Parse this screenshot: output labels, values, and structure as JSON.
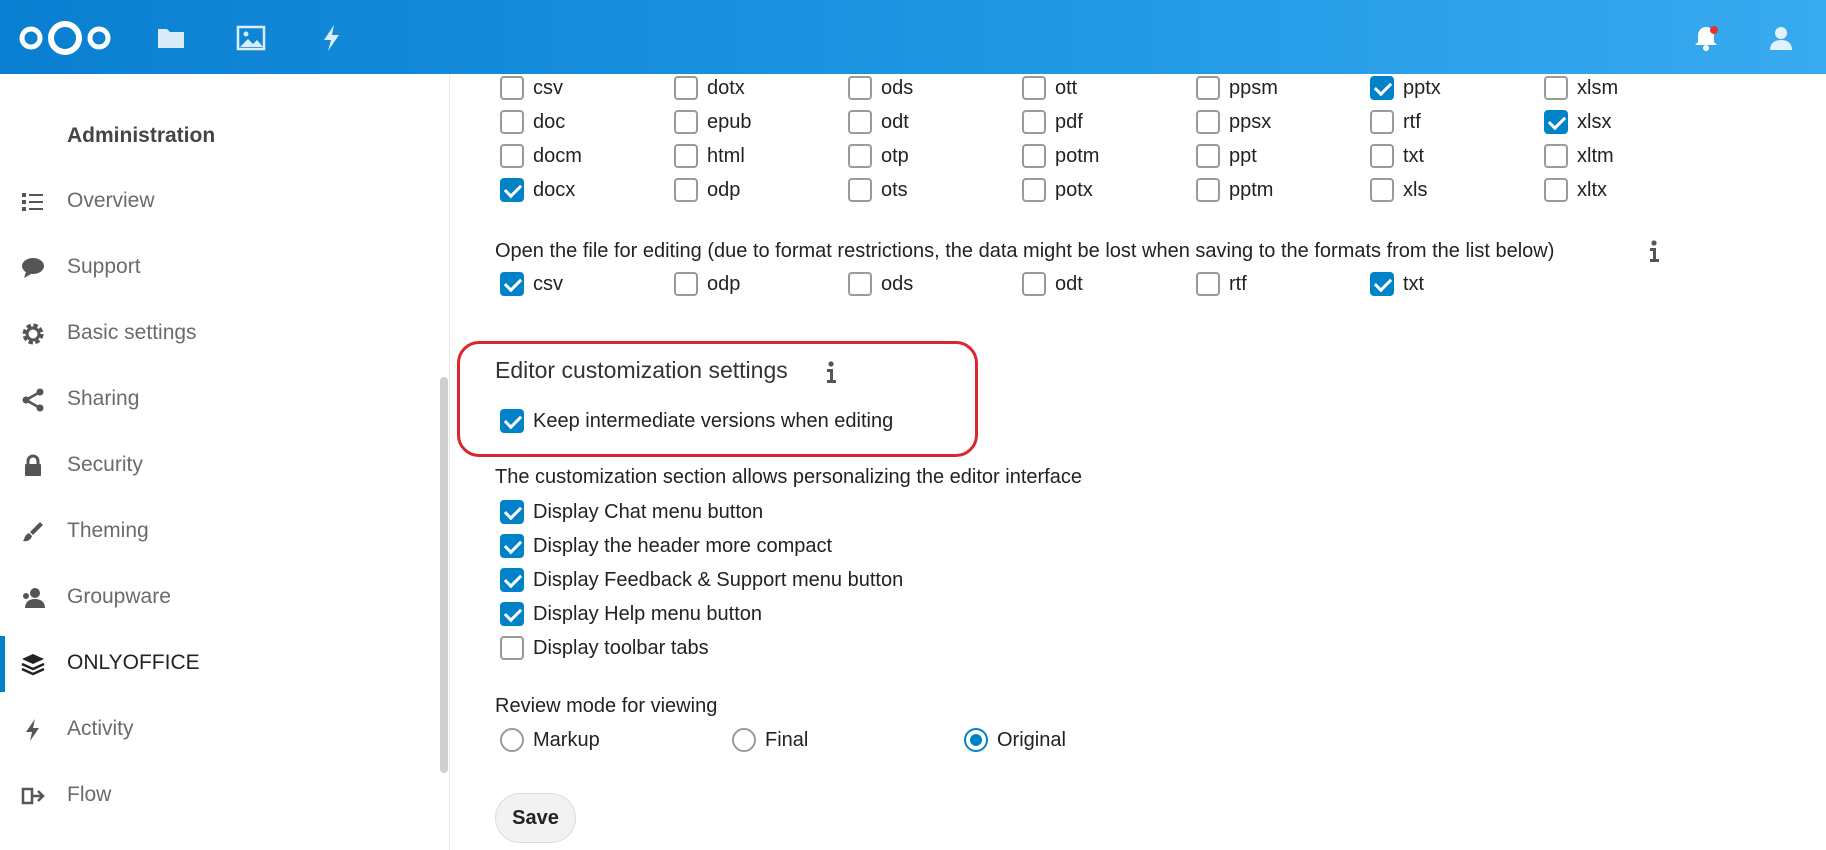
{
  "header": {
    "icons": [
      "files-icon",
      "photos-icon",
      "activity-icon"
    ],
    "right_icons": [
      "notifications-icon",
      "user-avatar-icon"
    ],
    "accent": "#0082c9"
  },
  "sidebar": {
    "heading": "Administration",
    "items": [
      {
        "label": "Overview",
        "icon": "list-icon"
      },
      {
        "label": "Support",
        "icon": "speech-bubble-icon"
      },
      {
        "label": "Basic settings",
        "icon": "gear-icon"
      },
      {
        "label": "Sharing",
        "icon": "share-icon"
      },
      {
        "label": "Security",
        "icon": "lock-icon"
      },
      {
        "label": "Theming",
        "icon": "paint-brush-icon"
      },
      {
        "label": "Groupware",
        "icon": "group-icon"
      },
      {
        "label": "ONLYOFFICE",
        "icon": "layers-icon",
        "active": true
      },
      {
        "label": "Activity",
        "icon": "lightning-icon"
      },
      {
        "label": "Flow",
        "icon": "flow-icon"
      }
    ]
  },
  "formats": {
    "rows": [
      [
        {
          "l": "csv",
          "c": false
        },
        {
          "l": "dotx",
          "c": false
        },
        {
          "l": "ods",
          "c": false
        },
        {
          "l": "ott",
          "c": false
        },
        {
          "l": "ppsm",
          "c": false
        },
        {
          "l": "pptx",
          "c": true
        },
        {
          "l": "xlsm",
          "c": false
        }
      ],
      [
        {
          "l": "doc",
          "c": false
        },
        {
          "l": "epub",
          "c": false
        },
        {
          "l": "odt",
          "c": false
        },
        {
          "l": "pdf",
          "c": false
        },
        {
          "l": "ppsx",
          "c": false
        },
        {
          "l": "rtf",
          "c": false
        },
        {
          "l": "xlsx",
          "c": true
        }
      ],
      [
        {
          "l": "docm",
          "c": false
        },
        {
          "l": "html",
          "c": false
        },
        {
          "l": "otp",
          "c": false
        },
        {
          "l": "potm",
          "c": false
        },
        {
          "l": "ppt",
          "c": false
        },
        {
          "l": "txt",
          "c": false
        },
        {
          "l": "xltm",
          "c": false
        }
      ],
      [
        {
          "l": "docx",
          "c": true
        },
        {
          "l": "odp",
          "c": false
        },
        {
          "l": "ots",
          "c": false
        },
        {
          "l": "potx",
          "c": false
        },
        {
          "l": "pptm",
          "c": false
        },
        {
          "l": "xls",
          "c": false
        },
        {
          "l": "xltx",
          "c": false
        }
      ]
    ]
  },
  "edit_formats": {
    "label": "Open the file for editing (due to format restrictions, the data might be lost when saving to the formats from the list below)",
    "items": [
      {
        "l": "csv",
        "c": true
      },
      {
        "l": "odp",
        "c": false
      },
      {
        "l": "ods",
        "c": false
      },
      {
        "l": "odt",
        "c": false
      },
      {
        "l": "rtf",
        "c": false
      },
      {
        "l": "txt",
        "c": true
      }
    ]
  },
  "editor_customization": {
    "title": "Editor customization settings",
    "keep_versions": {
      "label": "Keep intermediate versions when editing",
      "checked": true
    }
  },
  "customization": {
    "description": "The customization section allows personalizing the editor interface",
    "items": [
      {
        "label": "Display Chat menu button",
        "checked": true
      },
      {
        "label": "Display the header more compact",
        "checked": true
      },
      {
        "label": "Display Feedback & Support menu button",
        "checked": true
      },
      {
        "label": "Display Help menu button",
        "checked": true
      },
      {
        "label": "Display toolbar tabs",
        "checked": false
      }
    ]
  },
  "review_mode": {
    "label": "Review mode for viewing",
    "options": [
      {
        "label": "Markup",
        "selected": false
      },
      {
        "label": "Final",
        "selected": false
      },
      {
        "label": "Original",
        "selected": true
      }
    ]
  },
  "save_label": "Save"
}
